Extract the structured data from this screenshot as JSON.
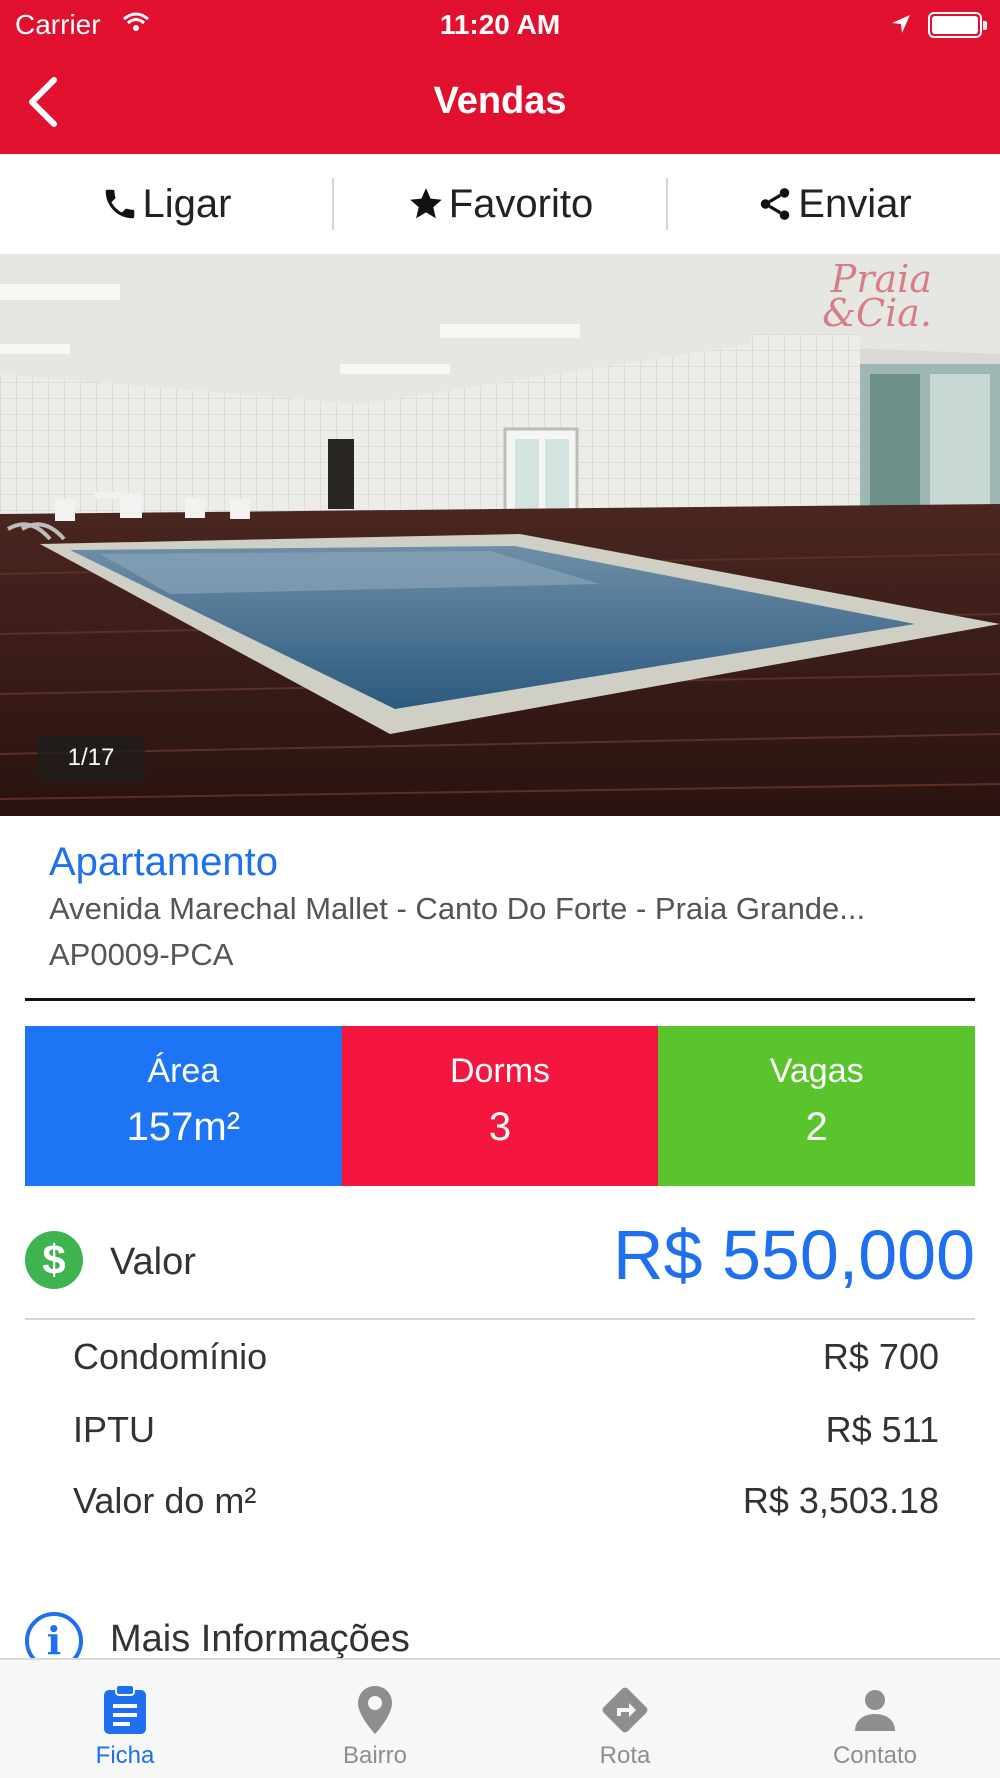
{
  "status_bar": {
    "carrier": "Carrier",
    "time": "11:20 AM"
  },
  "nav": {
    "title": "Vendas"
  },
  "actions": {
    "call": "Ligar",
    "favorite": "Favorito",
    "send": "Enviar"
  },
  "photo": {
    "counter": "1/17",
    "watermark_line1": "Praia",
    "watermark_line2": "&Cia."
  },
  "listing": {
    "type": "Apartamento",
    "address": "Avenida Marechal Mallet - Canto Do Forte - Praia Grande...",
    "code": "AP0009-PCA"
  },
  "stats": {
    "area_label": "Área",
    "area_value": "157m²",
    "dorms_label": "Dorms",
    "dorms_value": "3",
    "vagas_label": "Vagas",
    "vagas_value": "2"
  },
  "price": {
    "label": "Valor",
    "value": "R$ 550,000"
  },
  "details": [
    {
      "label": "Condomínio",
      "value": "R$ 700"
    },
    {
      "label": "IPTU",
      "value": "R$ 511"
    },
    {
      "label": "Valor do m²",
      "value": "R$ 3,503.18"
    }
  ],
  "more_info": {
    "label": "Mais Informações"
  },
  "tabs": [
    {
      "label": "Ficha",
      "icon": "clipboard-icon",
      "active": true
    },
    {
      "label": "Bairro",
      "icon": "map-pin-icon",
      "active": false
    },
    {
      "label": "Rota",
      "icon": "route-icon",
      "active": false
    },
    {
      "label": "Contato",
      "icon": "person-icon",
      "active": false
    }
  ],
  "colors": {
    "brand_red": "#e1102f",
    "link_blue": "#1e70f0",
    "area_blue": "#1d74f5",
    "dorms_red": "#f5163f",
    "vagas_green": "#5ac42d",
    "dollar_green": "#3db450"
  }
}
